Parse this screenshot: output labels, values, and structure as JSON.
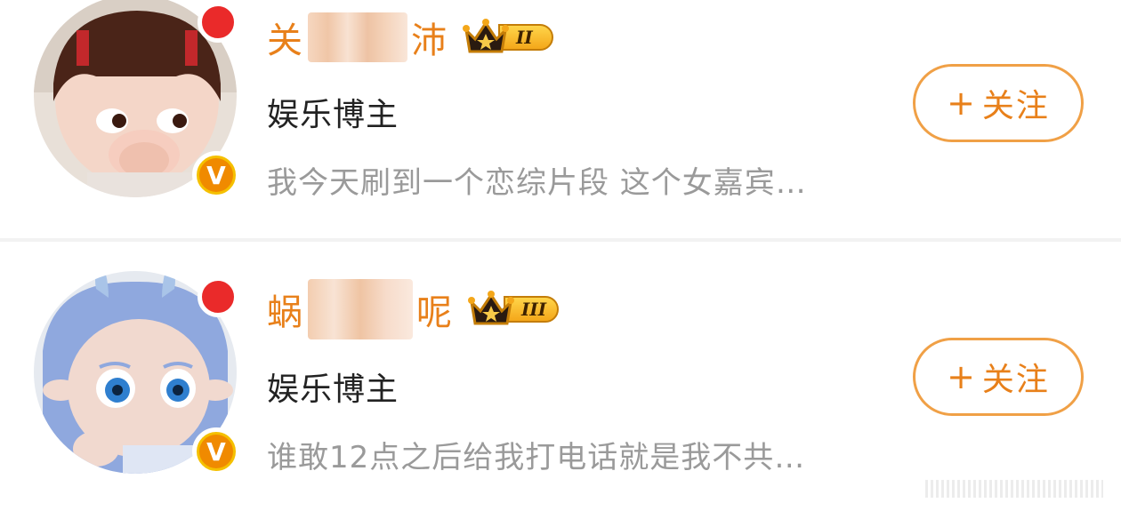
{
  "cards": [
    {
      "name_first": "关",
      "name_last": "沛",
      "level": "II",
      "role": "娱乐博主",
      "desc": "我今天刷到一个恋综片段 这个女嘉宾…",
      "follow_label": "关注",
      "follow_plus": "+"
    },
    {
      "name_first": "蜗",
      "name_last": "呢",
      "level": "III",
      "role": "娱乐博主",
      "desc": "谁敢12点之后给我打电话就是我不共…",
      "follow_label": "关注",
      "follow_plus": "+"
    }
  ],
  "icons": {
    "crown": "crown-icon",
    "verified": "verified-v-icon",
    "online": "online-dot-icon"
  },
  "colors": {
    "accent": "#e8801a",
    "online": "#ea2a2a",
    "verified": "#f08a00"
  },
  "v_symbol": "V"
}
